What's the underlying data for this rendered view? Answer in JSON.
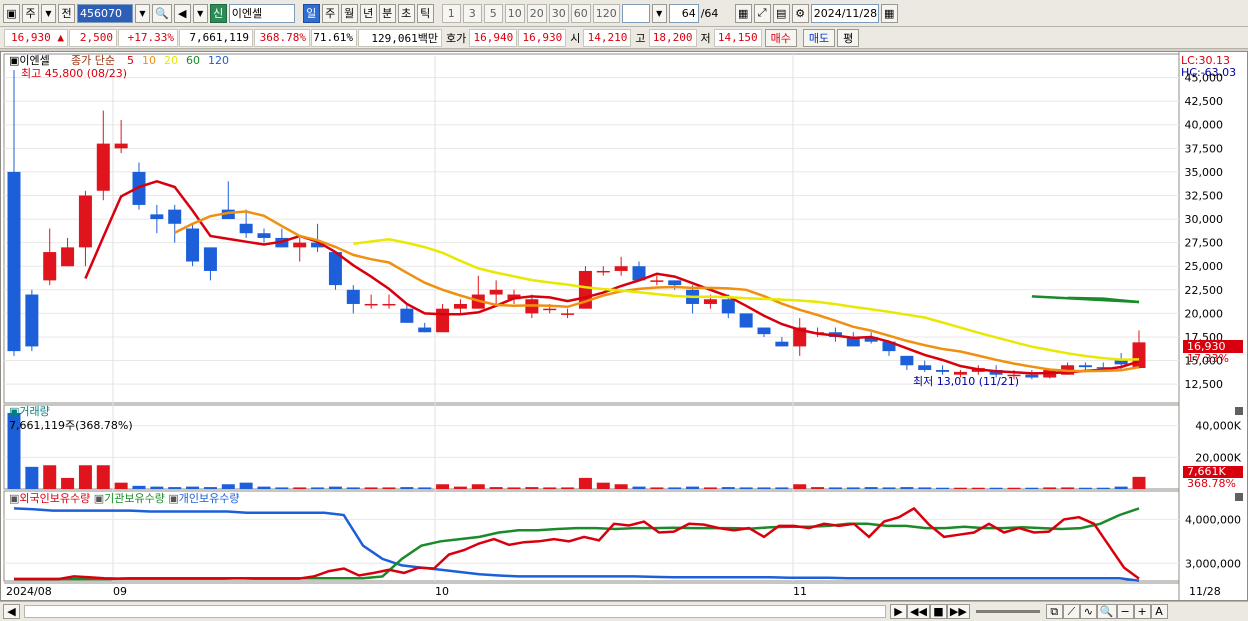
{
  "toolbar": {
    "market": "주",
    "prev": "전",
    "code": "456070",
    "new_badge": "신",
    "name": "이엔셀",
    "periods": [
      "일",
      "주",
      "월",
      "년",
      "분",
      "초",
      "틱"
    ],
    "active_period": "일",
    "intervals": [
      "1",
      "3",
      "5",
      "10",
      "20",
      "30",
      "60",
      "120"
    ],
    "count": "64",
    "count_total": "/64",
    "date": "2024/11/28"
  },
  "infobar": {
    "price": "16,930 ▲",
    "change": "2,500",
    "change_pct": "+17.33%",
    "volume": "7,661,119",
    "volume_ratio": "368.78%",
    "turnover": "71.61%",
    "amount": "129,061백만",
    "quote_label": "호가",
    "ask": "16,940",
    "bid": "16,930",
    "open_label": "시",
    "open": "14,210",
    "high_label": "고",
    "high": "18,200",
    "low_label": "저",
    "low": "14,150",
    "buy_label": "매수",
    "sell_label": "매도",
    "avg_label": "평"
  },
  "price_pane": {
    "stock_label": "이엔셀",
    "ma_label": "종가 단순",
    "ma_periods": [
      "5",
      "10",
      "20",
      "60",
      "120"
    ],
    "ma_colors": [
      "#d9000e",
      "#f09010",
      "#e8e800",
      "#1a8a2a",
      "#1c5fd8"
    ],
    "high_annotation": "최고 45,800 (08/23)",
    "low_annotation": "최저 13,010 (11/21)",
    "lc": "LC:30.13",
    "hc": "HC:-63.03",
    "current_price": "16,930",
    "current_pct": "17.33%",
    "y_ticks": [
      "45,000",
      "42,500",
      "40,000",
      "37,500",
      "35,000",
      "32,500",
      "30,000",
      "27,500",
      "25,000",
      "22,500",
      "20,000",
      "17,500",
      "15,000",
      "12,500"
    ]
  },
  "volume_pane": {
    "title": "거래량",
    "info": "7,661,119주(368.78%)",
    "y_ticks": [
      "40,000K",
      "20,000K"
    ],
    "current": "7,661K",
    "current_pct": "368.78%"
  },
  "holding_pane": {
    "labels": [
      "외국인보유수량",
      "기관보유수량",
      "개인보유수량"
    ],
    "colors": [
      "#d9000e",
      "#1a8a2a",
      "#1c5fd8"
    ],
    "y_ticks": [
      "4,000,000",
      "3,000,000"
    ]
  },
  "x_axis": {
    "labels": [
      "2024/08",
      "09",
      "10",
      "11"
    ],
    "end_label": "11/28"
  },
  "chart_data": {
    "type": "candlestick",
    "candles": [
      [
        35000,
        45800,
        15500,
        16000
      ],
      [
        22000,
        22500,
        16000,
        16500
      ],
      [
        23500,
        29000,
        23000,
        26500
      ],
      [
        25000,
        28000,
        25000,
        27000
      ],
      [
        27000,
        33000,
        25000,
        32500
      ],
      [
        33000,
        41500,
        32000,
        38000
      ],
      [
        37500,
        40500,
        37000,
        38000
      ],
      [
        35000,
        36000,
        31000,
        31500
      ],
      [
        30500,
        31500,
        28500,
        30000
      ],
      [
        31000,
        31500,
        27500,
        29500
      ],
      [
        29000,
        29500,
        25000,
        25500
      ],
      [
        27000,
        27000,
        23500,
        24500
      ],
      [
        31000,
        34000,
        30000,
        30000
      ],
      [
        29500,
        31000,
        28000,
        28500
      ],
      [
        28500,
        29000,
        27500,
        28000
      ],
      [
        28000,
        29000,
        27000,
        27000
      ],
      [
        27000,
        28000,
        25500,
        27500
      ],
      [
        27500,
        29500,
        26500,
        27000
      ],
      [
        26500,
        26500,
        22500,
        23000
      ],
      [
        22500,
        23000,
        20000,
        21000
      ],
      [
        21000,
        22000,
        20500,
        21000
      ],
      [
        21000,
        22000,
        20500,
        21000
      ],
      [
        20500,
        21000,
        19000,
        19000
      ],
      [
        18500,
        19000,
        18000,
        18000
      ],
      [
        18000,
        21000,
        18000,
        20500
      ],
      [
        20500,
        21500,
        20000,
        21000
      ],
      [
        20500,
        24000,
        20500,
        22000
      ],
      [
        22000,
        23500,
        21000,
        22500
      ],
      [
        21500,
        22500,
        21000,
        22000
      ],
      [
        20000,
        22000,
        19500,
        21500
      ],
      [
        20500,
        21000,
        20000,
        20500
      ],
      [
        20000,
        20500,
        19500,
        20000
      ],
      [
        20500,
        25000,
        20500,
        24500
      ],
      [
        24500,
        25000,
        24000,
        24500
      ],
      [
        24500,
        26000,
        24000,
        25000
      ],
      [
        25000,
        25500,
        23500,
        23500
      ],
      [
        23500,
        24000,
        23000,
        23500
      ],
      [
        23500,
        23500,
        22500,
        23000
      ],
      [
        22500,
        23000,
        20000,
        21000
      ],
      [
        21000,
        22000,
        20500,
        21500
      ],
      [
        21500,
        22000,
        19500,
        20000
      ],
      [
        20000,
        20000,
        18500,
        18500
      ],
      [
        18500,
        18500,
        17500,
        17800
      ],
      [
        17000,
        17500,
        16500,
        16500
      ],
      [
        16500,
        19500,
        15500,
        18500
      ],
      [
        18000,
        18500,
        17500,
        18000
      ],
      [
        18000,
        18500,
        17000,
        17500
      ],
      [
        17500,
        18000,
        16500,
        16500
      ],
      [
        17500,
        18000,
        16800,
        17000
      ],
      [
        17000,
        17000,
        15500,
        16000
      ],
      [
        15500,
        15500,
        14000,
        14500
      ],
      [
        14500,
        15000,
        13800,
        14000
      ],
      [
        14000,
        14500,
        13500,
        13800
      ],
      [
        13500,
        14000,
        13200,
        13800
      ],
      [
        13800,
        14500,
        13500,
        14200
      ],
      [
        14000,
        14500,
        13200,
        13500
      ],
      [
        13500,
        14000,
        13000,
        13500
      ],
      [
        13500,
        14000,
        13010,
        13200
      ],
      [
        13200,
        14000,
        13100,
        14000
      ],
      [
        13500,
        14800,
        13500,
        14500
      ],
      [
        14500,
        14800,
        14000,
        14300
      ],
      [
        14300,
        14800,
        14000,
        14200
      ],
      [
        15000,
        15800,
        14000,
        14600
      ],
      [
        14210,
        18200,
        14150,
        16930
      ]
    ],
    "volume": [
      48000000,
      14000000,
      15000000,
      7000000,
      15000000,
      15000000,
      4000000,
      2000000,
      1500000,
      1200000,
      1500000,
      1200000,
      3000000,
      4000000,
      1500000,
      1000000,
      1000000,
      1000000,
      1500000,
      1000000,
      1000000,
      1000000,
      1200000,
      1000000,
      3000000,
      1500000,
      3000000,
      1200000,
      1000000,
      1200000,
      1000000,
      1000000,
      7000000,
      4000000,
      3000000,
      1500000,
      1000000,
      1000000,
      1500000,
      1000000,
      1200000,
      1000000,
      1000000,
      1000000,
      3000000,
      1200000,
      1000000,
      1000000,
      1200000,
      1000000,
      1200000,
      1000000,
      800000,
      800000,
      800000,
      800000,
      800000,
      800000,
      1000000,
      1000000,
      800000,
      800000,
      1500000,
      7661119
    ],
    "foreign_holding": [
      2640000,
      2640000,
      2640000,
      2640000,
      2700000,
      2680000,
      2660000,
      2650000,
      2650000,
      2650000,
      2650000,
      2650000,
      2650000,
      2650000,
      2650000,
      2660000,
      2650000,
      2650000,
      2650000,
      2650000,
      2700000,
      2820000,
      2880000,
      2720000,
      2780000,
      2850000,
      2780000,
      2900000,
      2880000,
      3200000,
      3300000,
      3450000,
      3550000,
      3420000,
      3480000,
      3500000,
      3550000,
      3500000,
      3600000,
      3520000,
      3900000,
      3860000,
      3950000,
      3700000,
      3720000,
      3900000,
      3880000,
      3800000,
      3750000,
      3800000,
      3600000,
      3850000,
      3850000,
      3800000,
      3900000,
      3850000,
      3900000,
      3600000,
      3950000,
      4050000,
      4250000,
      3880000,
      3600000,
      3650000,
      3700000,
      3900000,
      3700000,
      3800000,
      3700000,
      3720000,
      4000000,
      4050000,
      3900000,
      3400000,
      2900000,
      2650000
    ],
    "institution_holding": [
      2640000,
      2640000,
      2640000,
      2640000,
      2640000,
      2640000,
      2660000,
      2660000,
      2660000,
      2660000,
      2660000,
      2660000,
      2660000,
      2660000,
      2660000,
      2660000,
      2660000,
      2660000,
      2660000,
      2700000,
      3100000,
      3400000,
      3500000,
      3550000,
      3600000,
      3700000,
      3750000,
      3750000,
      3780000,
      3800000,
      3800000,
      3780000,
      3800000,
      3800000,
      3810000,
      3800000,
      3800000,
      3800000,
      3790000,
      3820000,
      3830000,
      3830000,
      3850000,
      3900000,
      3900000,
      3850000,
      3850000,
      3800000,
      3800000,
      3830000,
      3800000,
      3800000,
      3820000,
      3800000,
      3780000,
      3800000,
      3900000,
      4100000,
      4250000
    ],
    "individual_holding": [
      4250000,
      4230000,
      4200000,
      4200000,
      4200000,
      4200000,
      4200000,
      4180000,
      4180000,
      4180000,
      4180000,
      4180000,
      4150000,
      4150000,
      4150000,
      4150000,
      4150000,
      4100000,
      3400000,
      3100000,
      2950000,
      2900000,
      2850000,
      2800000,
      2750000,
      2720000,
      2700000,
      2700000,
      2700000,
      2700000,
      2700000,
      2700000,
      2700000,
      2690000,
      2680000,
      2680000,
      2680000,
      2680000,
      2680000,
      2680000,
      2670000,
      2670000,
      2670000,
      2660000,
      2660000,
      2660000,
      2660000,
      2660000,
      2660000,
      2660000,
      2660000,
      2660000,
      2660000,
      2660000,
      2660000,
      2660000,
      2660000,
      2660000,
      2600000
    ]
  }
}
